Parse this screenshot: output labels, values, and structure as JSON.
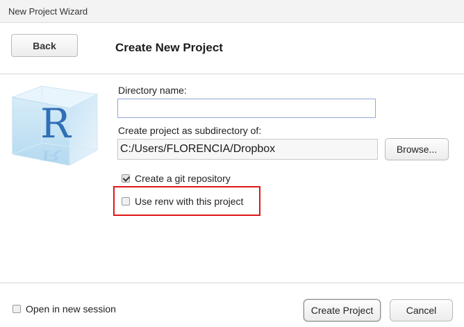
{
  "window": {
    "title": "New Project Wizard"
  },
  "header": {
    "back_label": "Back",
    "title": "Create New Project"
  },
  "form": {
    "directory_name_label": "Directory name:",
    "directory_name_value": "",
    "subdirectory_label": "Create project as subdirectory of:",
    "subdirectory_value": "C:/Users/FLORENCIA/Dropbox",
    "browse_label": "Browse...",
    "git_label": "Create a git repository",
    "git_checked": true,
    "renv_label": "Use renv with this project",
    "renv_checked": false
  },
  "footer": {
    "new_session_label": "Open in new session",
    "new_session_checked": false,
    "create_label": "Create Project",
    "cancel_label": "Cancel"
  },
  "icons": {
    "logo": "r-project-cube-icon",
    "back": "back-arrow-button"
  },
  "colors": {
    "highlight": "#e01515",
    "input_focus": "#8fa6d8",
    "logo_letter": "#2f6fb6"
  }
}
